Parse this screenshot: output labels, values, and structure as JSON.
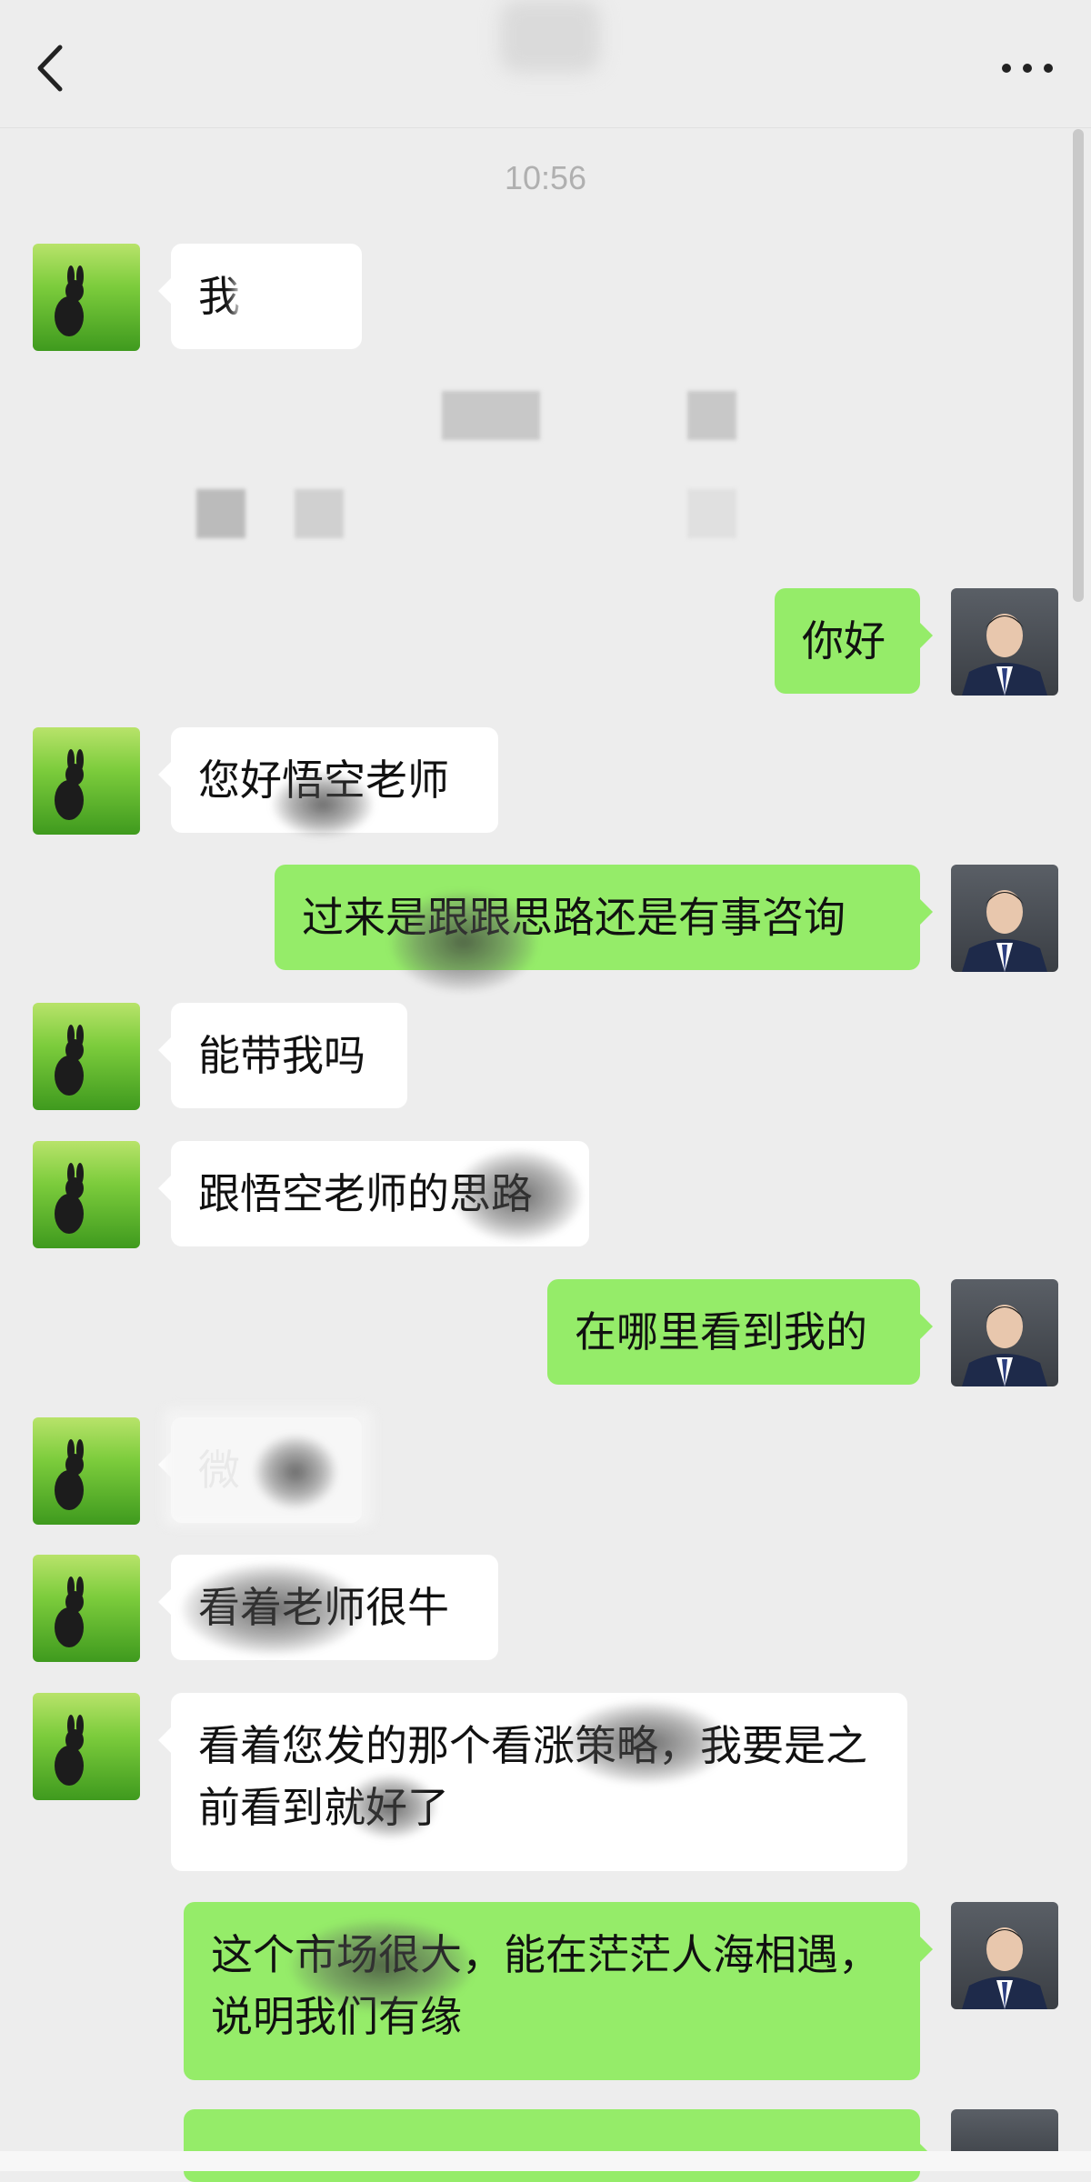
{
  "header": {
    "back_icon": "chevron-left-icon",
    "more_icon": "more-dots-icon",
    "title": ""
  },
  "timestamp": "10:56",
  "messages": [
    {
      "side": "left",
      "text": "我"
    },
    {
      "side": "right",
      "text": "你好"
    },
    {
      "side": "left",
      "text": "您好悟空老师"
    },
    {
      "side": "right",
      "text": "过来是跟跟思路还是有事咨询"
    },
    {
      "side": "left",
      "text": "能带我吗"
    },
    {
      "side": "left",
      "text": "跟悟空老师的思路"
    },
    {
      "side": "right",
      "text": "在哪里看到我的"
    },
    {
      "side": "left",
      "text": "微"
    },
    {
      "side": "left",
      "text": "看着老师很牛"
    },
    {
      "side": "left",
      "text": "看着您发的那个看涨策略，我要是之前看到就好了"
    },
    {
      "side": "right",
      "text": "这个市场很大，能在茫茫人海相遇，说明我们有缘"
    },
    {
      "side": "right",
      "text": ""
    }
  ],
  "colors": {
    "background": "#ededed",
    "bubble_self": "#95ec69",
    "bubble_other": "#ffffff"
  }
}
